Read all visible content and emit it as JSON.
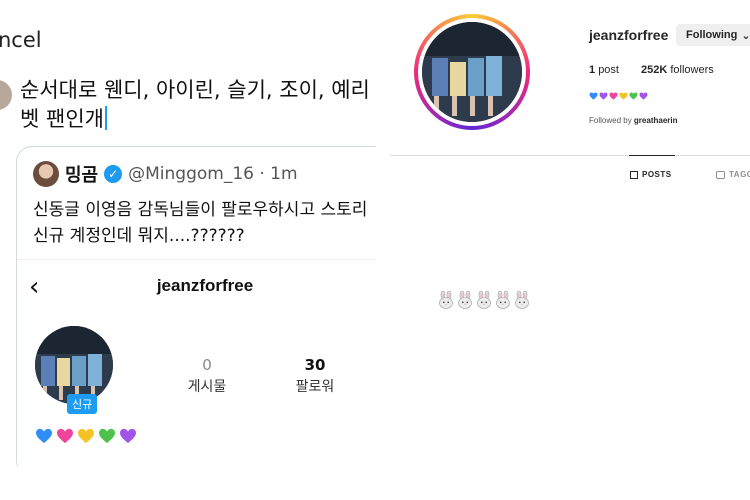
{
  "left": {
    "cancel_label": "ncel",
    "compose_text": "순서대로 웬디, 아이린, 슬기, 조이, 예리\n벳 팬인개",
    "quote": {
      "name": "밍곰",
      "handle_time": "@Minggom_16 · 1m",
      "text": "신동글 이영음 감독님들이 팔로우하시고 스토리\n신규 계정인데 뭐지....??????",
      "profile": {
        "back_icon": "chevron-left-icon",
        "username": "jeanzforfree",
        "new_badge": "신규",
        "posts_count": "0",
        "posts_label": "게시물",
        "followers_count": "30",
        "followers_label": "팔로워",
        "hearts": [
          "#2f8ef6",
          "#f0439b",
          "#f6c325",
          "#4cc24a",
          "#a253e8"
        ]
      }
    }
  },
  "right": {
    "username": "jeanzforfree",
    "follow_button": "Following",
    "posts_count": "1",
    "posts_label": "post",
    "followers_count": "252K",
    "followers_label": "followers",
    "hearts": [
      "#2f8ef6",
      "#a253e8",
      "#f0439b",
      "#f6c325",
      "#4cc24a",
      "#a253e8"
    ],
    "followed_by_prefix": "Followed by",
    "followed_by_user": "greathaerin",
    "tab_posts": "POSTS",
    "tab_tagged": "TAGG",
    "bunny_icon": "rabbit-face-icon",
    "bunny_count": 5
  }
}
